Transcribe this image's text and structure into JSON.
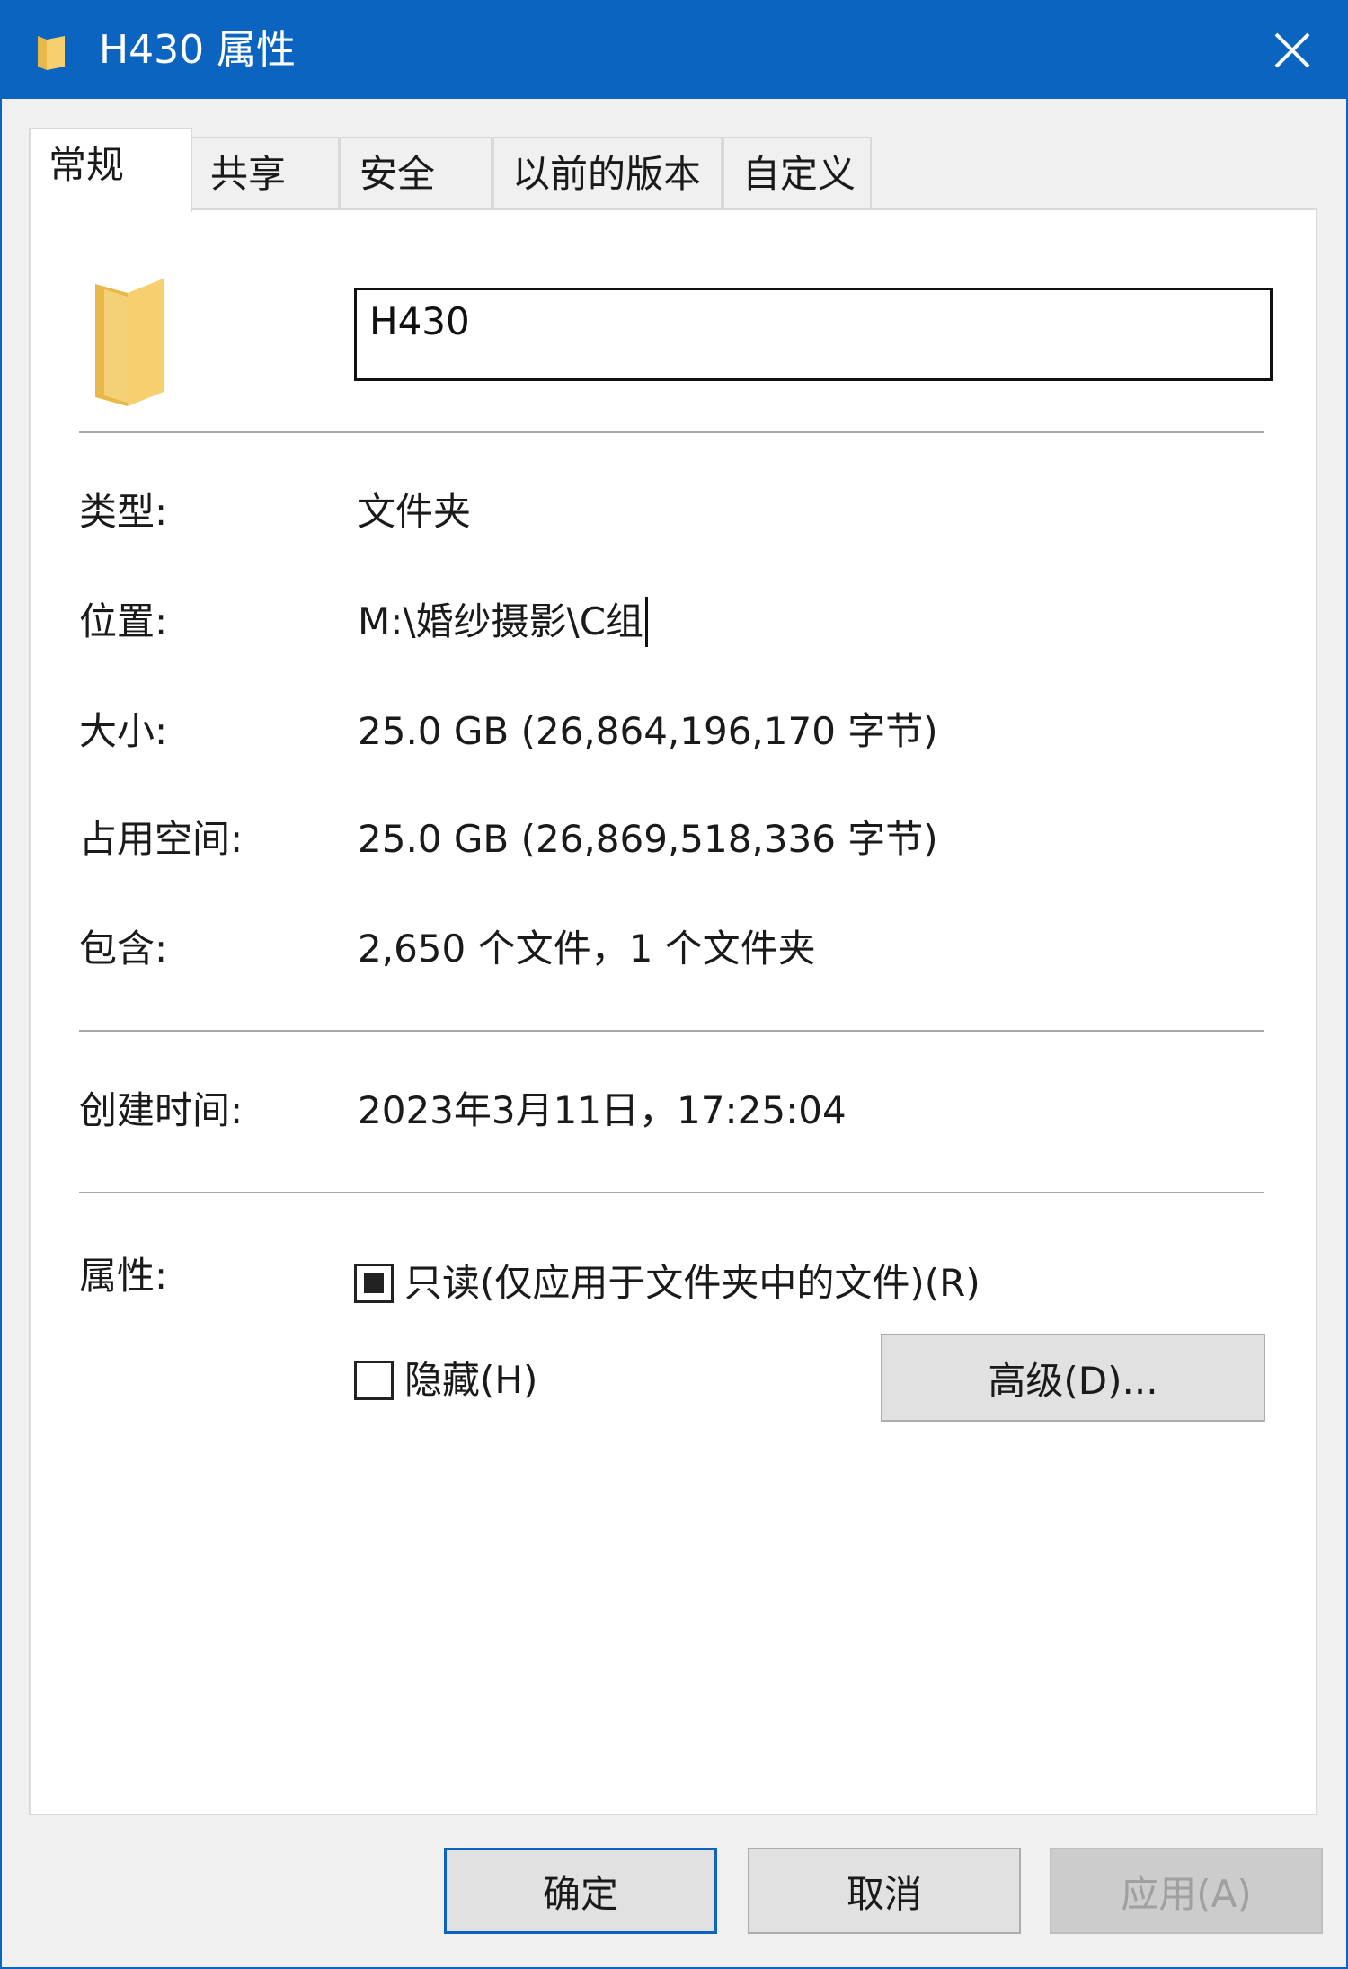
{
  "window": {
    "title": "H430 属性",
    "close_label": "关闭"
  },
  "tabs": [
    {
      "label": "常规",
      "active": true
    },
    {
      "label": "共享"
    },
    {
      "label": "安全"
    },
    {
      "label": "以前的版本"
    },
    {
      "label": "自定义"
    }
  ],
  "general": {
    "folder_name": "H430",
    "fields": [
      {
        "label": "类型:",
        "value": "文件夹"
      },
      {
        "label": "位置:",
        "value": "M:\\婚纱摄影\\C组"
      },
      {
        "label": "大小:",
        "value": "25.0 GB (26,864,196,170 字节)"
      },
      {
        "label": "占用空间:",
        "value": "25.0 GB (26,869,518,336 字节)"
      },
      {
        "label": "包含:",
        "value": "2,650 个文件，1 个文件夹"
      },
      {
        "label": "创建时间:",
        "value": "2023年3月11日，17:25:04"
      }
    ],
    "attributes": {
      "label": "属性:",
      "readonly_label": "只读(仅应用于文件夹中的文件)(R)",
      "readonly_state": "indeterminate",
      "hidden_label": "隐藏(H)",
      "hidden_checked": false,
      "advanced_button": "高级(D)..."
    }
  },
  "footer": {
    "ok": "确定",
    "cancel": "取消",
    "apply": "应用(A)"
  },
  "colors": {
    "titlebar": "#0a64c0",
    "folder": "#f6d06e"
  },
  "icons": {
    "title": "folder-icon",
    "close": "close-icon",
    "big": "folder-icon"
  }
}
